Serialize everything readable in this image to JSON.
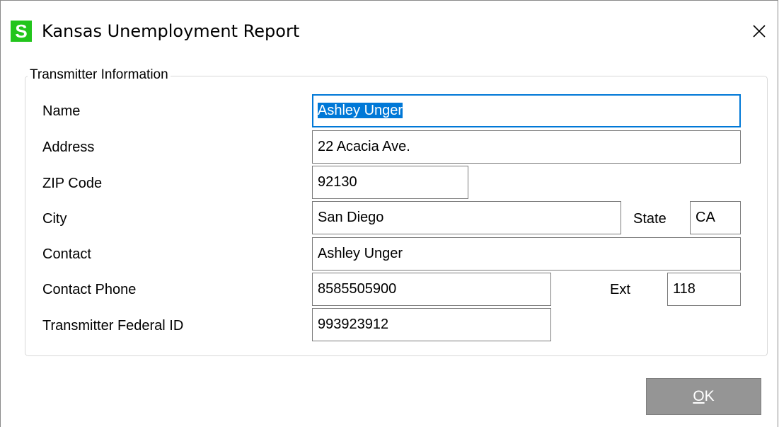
{
  "window": {
    "icon_letter": "S",
    "title": "Kansas Unemployment Report"
  },
  "group": {
    "label": "Transmitter Information"
  },
  "fields": {
    "name": {
      "label": "Name",
      "value": "Ashley Unger"
    },
    "address": {
      "label": "Address",
      "value": "22 Acacia Ave."
    },
    "zip": {
      "label": "ZIP Code",
      "value": "92130"
    },
    "city": {
      "label": "City",
      "value": "San Diego"
    },
    "state": {
      "label": "State",
      "value": "CA"
    },
    "contact": {
      "label": "Contact",
      "value": "Ashley Unger"
    },
    "phone": {
      "label": "Contact Phone",
      "value": "8585505900"
    },
    "ext": {
      "label": "Ext",
      "value": "118"
    },
    "federal_id": {
      "label": "Transmitter Federal ID",
      "value": "993923912"
    }
  },
  "buttons": {
    "ok_mnemonic": "O",
    "ok_rest": "K"
  },
  "colors": {
    "app_icon": "#22c51c",
    "focus_border": "#0078d7",
    "selection": "#0078d7",
    "ok_button": "#959595"
  },
  "icons": {
    "app": "sage-s-icon",
    "close": "close-icon"
  }
}
